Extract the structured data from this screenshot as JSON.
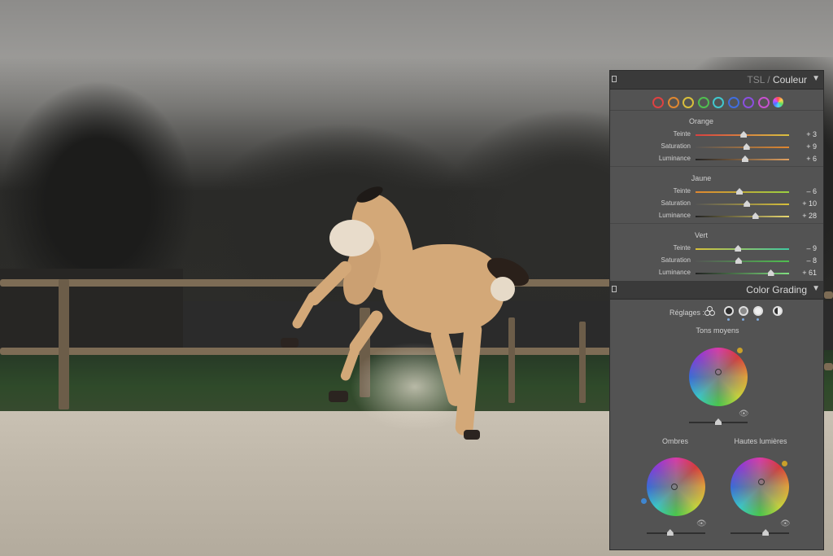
{
  "hsl_panel": {
    "title_dim": "TSL",
    "title_sep": " / ",
    "title": "Couleur",
    "collapse_icon": "triangle-down-icon",
    "swatches": [
      {
        "name": "red",
        "color": "#e04141"
      },
      {
        "name": "orange",
        "color": "#e0872f"
      },
      {
        "name": "yellow",
        "color": "#d8c03a"
      },
      {
        "name": "green",
        "color": "#4fc04f"
      },
      {
        "name": "aqua",
        "color": "#3fc8cf"
      },
      {
        "name": "blue",
        "color": "#3f6ee0"
      },
      {
        "name": "purple",
        "color": "#8a4fe0"
      },
      {
        "name": "magenta",
        "color": "#c84fd0"
      },
      {
        "name": "all",
        "color": "multicolor"
      }
    ],
    "groups": [
      {
        "title": "Orange",
        "rows": [
          {
            "label": "Teinte",
            "value": "+ 3",
            "level": 3
          },
          {
            "label": "Saturation",
            "value": "+ 9",
            "level": 9
          },
          {
            "label": "Luminance",
            "value": "+ 6",
            "level": 6
          }
        ]
      },
      {
        "title": "Jaune",
        "rows": [
          {
            "label": "Teinte",
            "value": "– 6",
            "level": -6
          },
          {
            "label": "Saturation",
            "value": "+ 10",
            "level": 10
          },
          {
            "label": "Luminance",
            "value": "+ 28",
            "level": 28
          }
        ]
      },
      {
        "title": "Vert",
        "rows": [
          {
            "label": "Teinte",
            "value": "– 9",
            "level": -9
          },
          {
            "label": "Saturation",
            "value": "– 8",
            "level": -8
          },
          {
            "label": "Luminance",
            "value": "+ 61",
            "level": 61
          }
        ]
      }
    ]
  },
  "grading_panel": {
    "title": "Color Grading",
    "collapse_icon": "triangle-down-icon",
    "reglages_label": "Réglages :",
    "reglages_icons": [
      "three-way-icon",
      "shadows-wheel-icon",
      "midtones-wheel-icon",
      "highlights-wheel-icon",
      "global-wheel-icon"
    ],
    "midtones_label": "Tons moyens",
    "shadows_label": "Ombres",
    "highlights_label": "Hautes lumières",
    "eye_icon": "eye-icon",
    "midtones_accent": "#c9a02a",
    "shadows_accent": "#3f86d0",
    "highlights_accent": "#c9a02a"
  }
}
